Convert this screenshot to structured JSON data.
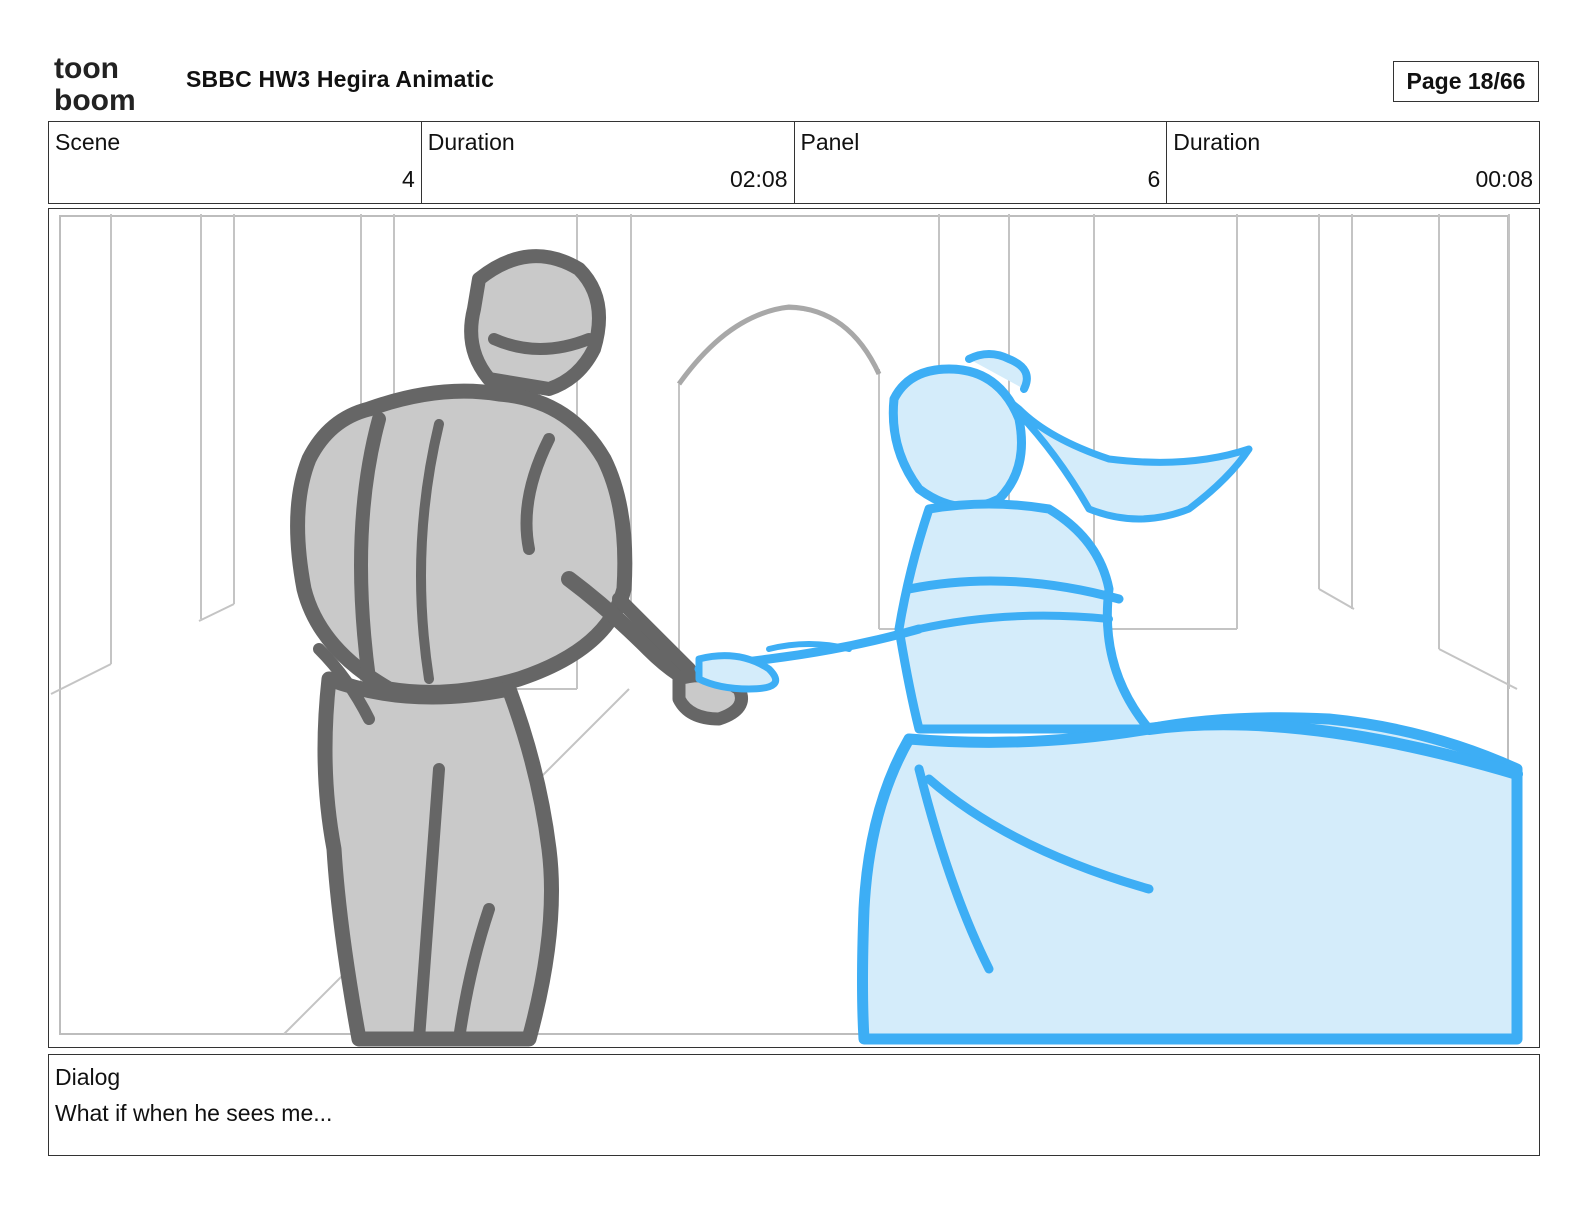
{
  "header": {
    "logo_text_top": "toon",
    "logo_text_bottom": "boom",
    "title": "SBBC HW3 Hegira Animatic",
    "page_label": "Page 18/66"
  },
  "info": [
    {
      "label": "Scene",
      "value": "4"
    },
    {
      "label": "Duration",
      "value": "02:08"
    },
    {
      "label": "Panel",
      "value": "6"
    },
    {
      "label": "Duration",
      "value": "00:08"
    }
  ],
  "panel": {
    "drawing": "storyboard-sketch",
    "colors": {
      "background_lines": "#c4c4c4",
      "figure_fill": "#c9c9c9",
      "figure_stroke": "#666666",
      "dress_fill": "#d4ecfa",
      "dress_stroke": "#3daef5"
    }
  },
  "dialog": {
    "label": "Dialog",
    "text": "What if when he sees me..."
  }
}
